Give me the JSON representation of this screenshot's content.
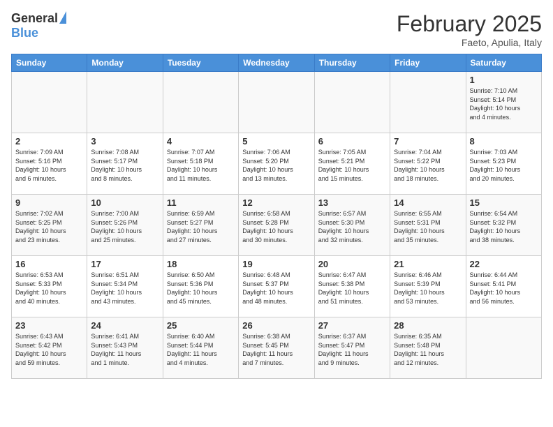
{
  "header": {
    "logo_general": "General",
    "logo_blue": "Blue",
    "title": "February 2025",
    "location": "Faeto, Apulia, Italy"
  },
  "days_of_week": [
    "Sunday",
    "Monday",
    "Tuesday",
    "Wednesday",
    "Thursday",
    "Friday",
    "Saturday"
  ],
  "weeks": [
    [
      {
        "day": "",
        "info": ""
      },
      {
        "day": "",
        "info": ""
      },
      {
        "day": "",
        "info": ""
      },
      {
        "day": "",
        "info": ""
      },
      {
        "day": "",
        "info": ""
      },
      {
        "day": "",
        "info": ""
      },
      {
        "day": "1",
        "info": "Sunrise: 7:10 AM\nSunset: 5:14 PM\nDaylight: 10 hours\nand 4 minutes."
      }
    ],
    [
      {
        "day": "2",
        "info": "Sunrise: 7:09 AM\nSunset: 5:16 PM\nDaylight: 10 hours\nand 6 minutes."
      },
      {
        "day": "3",
        "info": "Sunrise: 7:08 AM\nSunset: 5:17 PM\nDaylight: 10 hours\nand 8 minutes."
      },
      {
        "day": "4",
        "info": "Sunrise: 7:07 AM\nSunset: 5:18 PM\nDaylight: 10 hours\nand 11 minutes."
      },
      {
        "day": "5",
        "info": "Sunrise: 7:06 AM\nSunset: 5:20 PM\nDaylight: 10 hours\nand 13 minutes."
      },
      {
        "day": "6",
        "info": "Sunrise: 7:05 AM\nSunset: 5:21 PM\nDaylight: 10 hours\nand 15 minutes."
      },
      {
        "day": "7",
        "info": "Sunrise: 7:04 AM\nSunset: 5:22 PM\nDaylight: 10 hours\nand 18 minutes."
      },
      {
        "day": "8",
        "info": "Sunrise: 7:03 AM\nSunset: 5:23 PM\nDaylight: 10 hours\nand 20 minutes."
      }
    ],
    [
      {
        "day": "9",
        "info": "Sunrise: 7:02 AM\nSunset: 5:25 PM\nDaylight: 10 hours\nand 23 minutes."
      },
      {
        "day": "10",
        "info": "Sunrise: 7:00 AM\nSunset: 5:26 PM\nDaylight: 10 hours\nand 25 minutes."
      },
      {
        "day": "11",
        "info": "Sunrise: 6:59 AM\nSunset: 5:27 PM\nDaylight: 10 hours\nand 27 minutes."
      },
      {
        "day": "12",
        "info": "Sunrise: 6:58 AM\nSunset: 5:28 PM\nDaylight: 10 hours\nand 30 minutes."
      },
      {
        "day": "13",
        "info": "Sunrise: 6:57 AM\nSunset: 5:30 PM\nDaylight: 10 hours\nand 32 minutes."
      },
      {
        "day": "14",
        "info": "Sunrise: 6:55 AM\nSunset: 5:31 PM\nDaylight: 10 hours\nand 35 minutes."
      },
      {
        "day": "15",
        "info": "Sunrise: 6:54 AM\nSunset: 5:32 PM\nDaylight: 10 hours\nand 38 minutes."
      }
    ],
    [
      {
        "day": "16",
        "info": "Sunrise: 6:53 AM\nSunset: 5:33 PM\nDaylight: 10 hours\nand 40 minutes."
      },
      {
        "day": "17",
        "info": "Sunrise: 6:51 AM\nSunset: 5:34 PM\nDaylight: 10 hours\nand 43 minutes."
      },
      {
        "day": "18",
        "info": "Sunrise: 6:50 AM\nSunset: 5:36 PM\nDaylight: 10 hours\nand 45 minutes."
      },
      {
        "day": "19",
        "info": "Sunrise: 6:48 AM\nSunset: 5:37 PM\nDaylight: 10 hours\nand 48 minutes."
      },
      {
        "day": "20",
        "info": "Sunrise: 6:47 AM\nSunset: 5:38 PM\nDaylight: 10 hours\nand 51 minutes."
      },
      {
        "day": "21",
        "info": "Sunrise: 6:46 AM\nSunset: 5:39 PM\nDaylight: 10 hours\nand 53 minutes."
      },
      {
        "day": "22",
        "info": "Sunrise: 6:44 AM\nSunset: 5:41 PM\nDaylight: 10 hours\nand 56 minutes."
      }
    ],
    [
      {
        "day": "23",
        "info": "Sunrise: 6:43 AM\nSunset: 5:42 PM\nDaylight: 10 hours\nand 59 minutes."
      },
      {
        "day": "24",
        "info": "Sunrise: 6:41 AM\nSunset: 5:43 PM\nDaylight: 11 hours\nand 1 minute."
      },
      {
        "day": "25",
        "info": "Sunrise: 6:40 AM\nSunset: 5:44 PM\nDaylight: 11 hours\nand 4 minutes."
      },
      {
        "day": "26",
        "info": "Sunrise: 6:38 AM\nSunset: 5:45 PM\nDaylight: 11 hours\nand 7 minutes."
      },
      {
        "day": "27",
        "info": "Sunrise: 6:37 AM\nSunset: 5:47 PM\nDaylight: 11 hours\nand 9 minutes."
      },
      {
        "day": "28",
        "info": "Sunrise: 6:35 AM\nSunset: 5:48 PM\nDaylight: 11 hours\nand 12 minutes."
      },
      {
        "day": "",
        "info": ""
      }
    ]
  ]
}
